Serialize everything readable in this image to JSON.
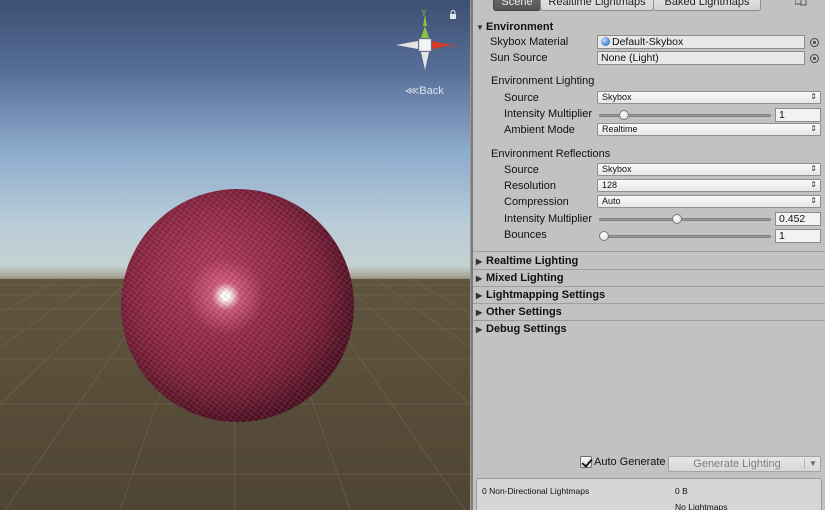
{
  "scene": {
    "back_label": "Back",
    "gizmo": {
      "y_label": "y",
      "x_label": "x"
    }
  },
  "colors": {
    "sphere": "#8d2443",
    "sky_top": "#3d4f73",
    "horizon": "#c8d2cf",
    "ground": "#5f553f",
    "gizmo_y": "#8ac43f",
    "gizmo_x": "#d63a2a",
    "panel_bg": "#c2c2c2"
  },
  "tabs": [
    {
      "label": "Scene",
      "active": true
    },
    {
      "label": "Realtime Lightmaps",
      "active": false
    },
    {
      "label": "Baked Lightmaps",
      "active": false
    }
  ],
  "environment": {
    "header": "Environment",
    "skybox_material": {
      "label": "Skybox Material",
      "value": "Default-Skybox"
    },
    "sun_source": {
      "label": "Sun Source",
      "value": "None (Light)"
    },
    "lighting": {
      "header": "Environment Lighting",
      "source": {
        "label": "Source",
        "value": "Skybox"
      },
      "intensity": {
        "label": "Intensity Multiplier",
        "value": "1",
        "fraction": 0.125
      },
      "ambient_mode": {
        "label": "Ambient Mode",
        "value": "Realtime"
      }
    },
    "reflections": {
      "header": "Environment Reflections",
      "source": {
        "label": "Source",
        "value": "Skybox"
      },
      "resolution": {
        "label": "Resolution",
        "value": "128"
      },
      "compression": {
        "label": "Compression",
        "value": "Auto"
      },
      "intensity": {
        "label": "Intensity Multiplier",
        "value": "0.452",
        "fraction": 0.452
      },
      "bounces": {
        "label": "Bounces",
        "value": "1",
        "fraction": 0.0
      }
    }
  },
  "sections": [
    "Realtime Lighting",
    "Mixed Lighting",
    "Lightmapping Settings",
    "Other Settings",
    "Debug Settings"
  ],
  "auto_generate": {
    "label": "Auto Generate",
    "checked": true
  },
  "generate_button": "Generate Lighting",
  "stats": {
    "lightmaps": "0 Non-Directional Lightmaps",
    "size": "0 B",
    "note": "No Lightmaps"
  }
}
